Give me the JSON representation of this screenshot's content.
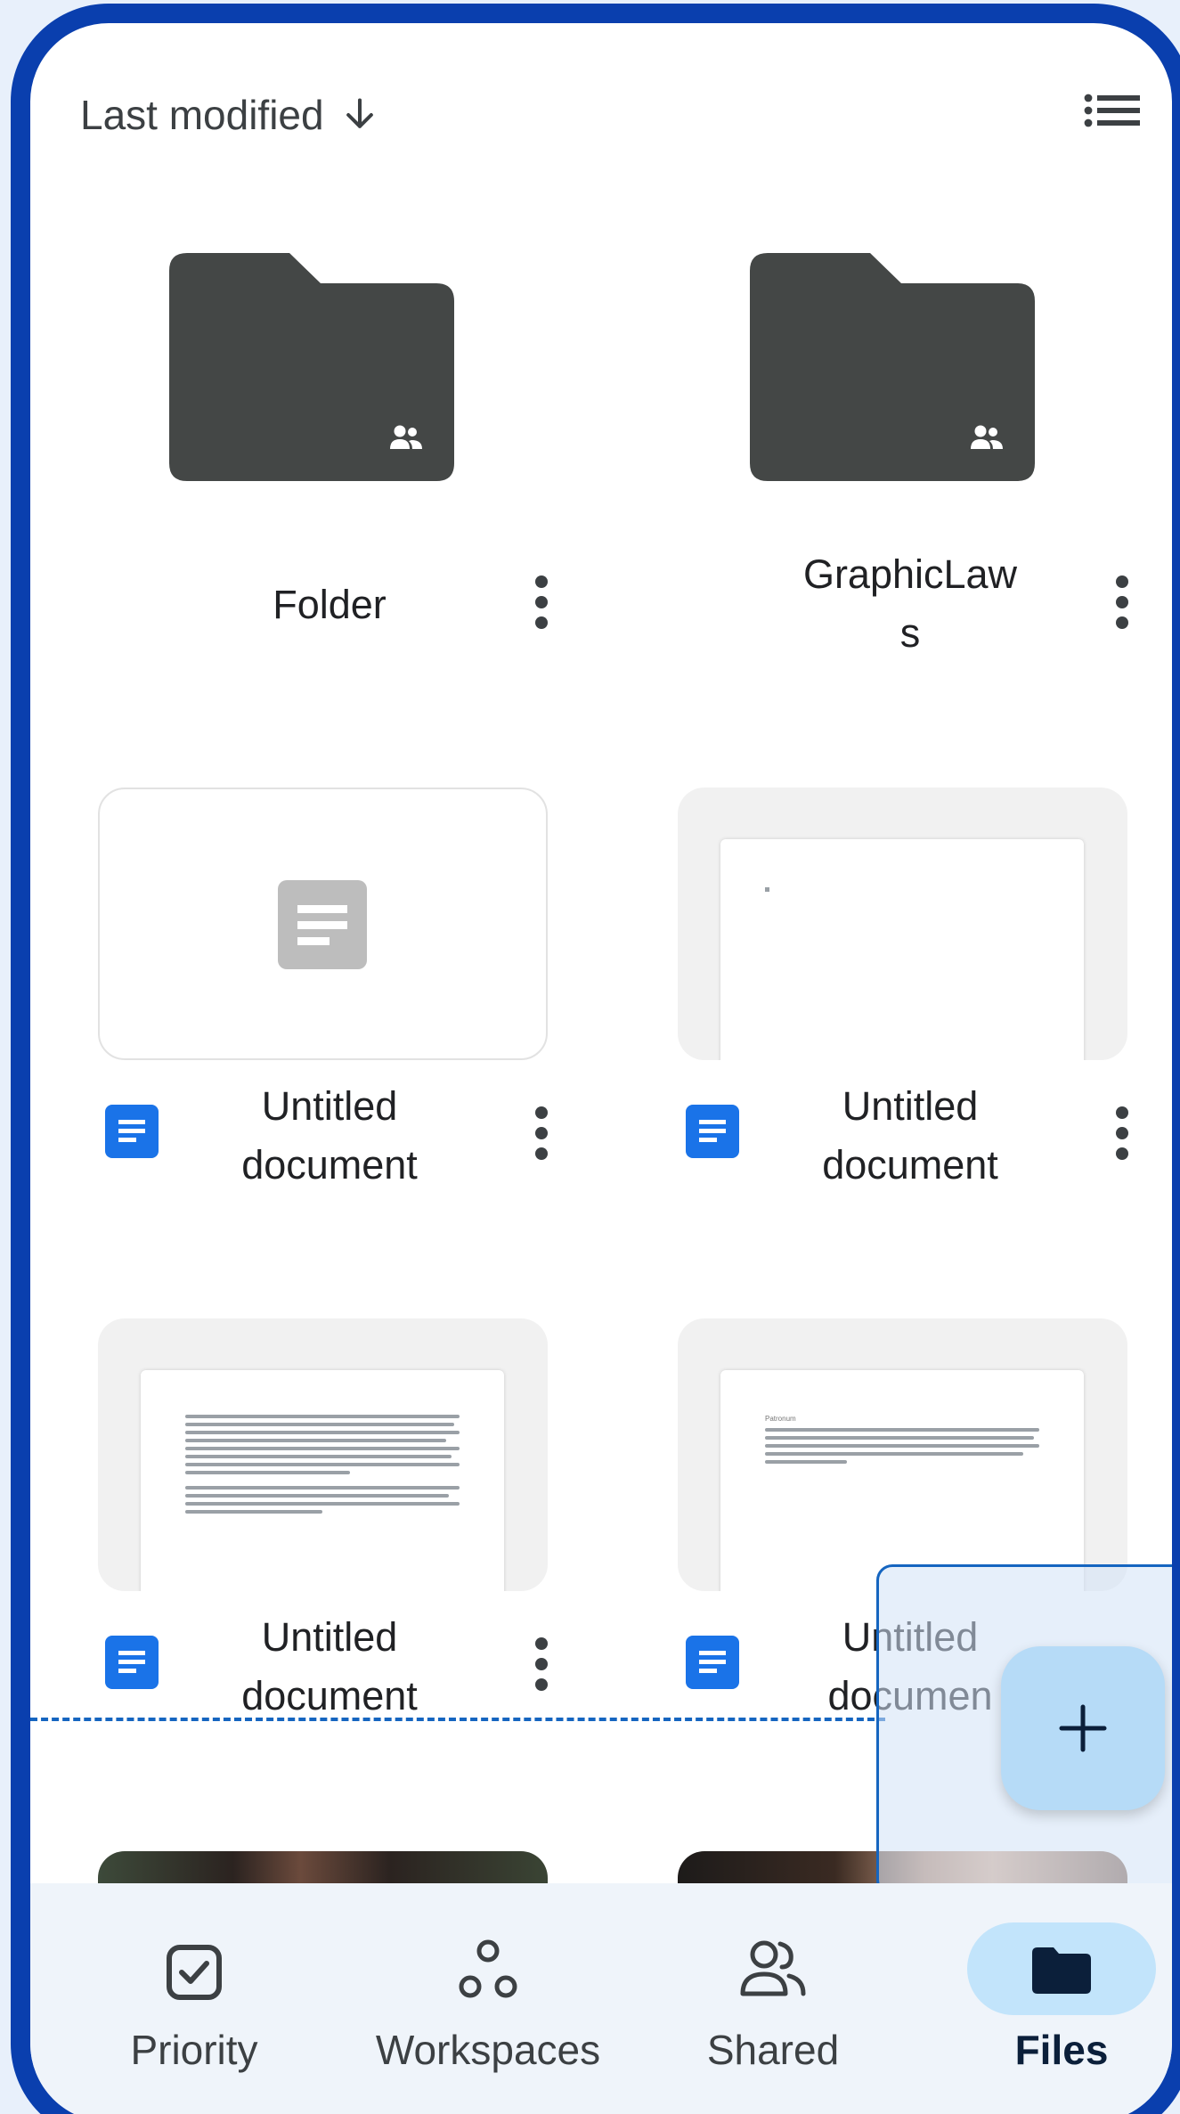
{
  "sort": {
    "label": "Last modified",
    "arrow_icon": "arrow-down-icon"
  },
  "view_toggle": {
    "icon": "list-view-icon"
  },
  "folders": [
    {
      "title": "Folder",
      "icon": "shared-folder-icon"
    },
    {
      "title_line1": "GraphicLaw",
      "title_line2": "s",
      "icon": "shared-folder-icon"
    }
  ],
  "docs": [
    {
      "line1": "Untitled",
      "line2": "document",
      "thumb": "blank-doc-placeholder"
    },
    {
      "line1": "Untitled",
      "line2": "document",
      "thumb": "page-preview"
    },
    {
      "line1": "Untitled",
      "line2": "document",
      "thumb": "page-preview-text"
    },
    {
      "line1": "Untitled",
      "line2": "documen",
      "thumb": "page-preview-text",
      "preview_heading": "Patronum"
    }
  ],
  "fab": {
    "icon": "plus-icon"
  },
  "nav": [
    {
      "label": "Priority",
      "icon": "priority-check-icon"
    },
    {
      "label": "Workspaces",
      "icon": "workspaces-icon"
    },
    {
      "label": "Shared",
      "icon": "shared-people-icon"
    },
    {
      "label": "Files",
      "icon": "folder-icon",
      "active": true
    }
  ],
  "colors": {
    "frame": "#0a3fae",
    "folder": "#444746",
    "docs_blue": "#1a73e8",
    "fab": "#b6dbf7",
    "nav_bg": "#eff4fa",
    "active_pill": "#c2e4fb"
  }
}
